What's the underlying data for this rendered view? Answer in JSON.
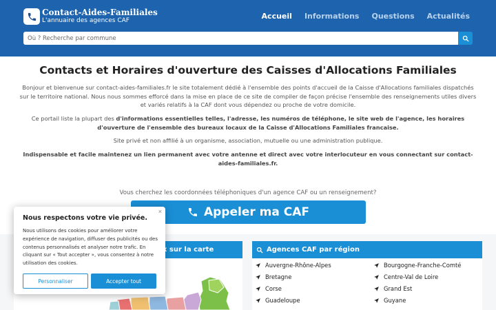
{
  "header": {
    "logo_title": "Contact-Aides-Familiales",
    "logo_subtitle": "L'annuaire des agences CAF",
    "nav": [
      "Accueil",
      "Informations",
      "Questions",
      "Actualités"
    ],
    "active_nav": "Accueil",
    "search": {
      "placeholder": "Où ? Recherche par commune",
      "value": ""
    }
  },
  "main": {
    "title": "Contacts et Horaires d'ouverture des Caisses d'Allocations Familiales",
    "intro": "Bonjour et bienvenue sur contact-aides-familiales.fr le site totalement dédié à l'ensemble des points d'accueil de la Caisse d'Allocations familiales dispatchés sur le territoire national. Nous nous sommes efforcé dans la mise en place de ce site de compiler de façon précise l'ensemble des renseignements utiles divers et variés relatifs à la CAF dont vous dépendez ou proche de votre domicile.",
    "portal_start": "Ce portail  liste la plupart des ",
    "portal_bold": "d'informations essentielles telles, l'adresse,  les numéros de téléphone, le site web de l'agence, les horaires d'ouverture de l'ensemble des bureaux locaux de la Caisse d'Allocations Familiales francaise.",
    "private": "Site privé et non affilié à un organisme, association, mutuelle ou une administration publique.",
    "link_text": "Indispensable et facile maintenez un lien permanent avec votre antenne et direct avec votre interlocuteur en vous connectant sur contact-aides-familiales.fr.",
    "question": "Vous cherchez les coordonnées téléphoniques d'un agence CAF ou un renseignement?",
    "call_button": "Appeler ma CAF"
  },
  "map_panel": {
    "title": "x sur la carte"
  },
  "regions_panel": {
    "title": "Agences CAF par région",
    "regions": [
      "Auvergne-Rhône-Alpes",
      "Bourgogne-Franche-Comté",
      "Bretagne",
      "Centre-Val de Loire",
      "Corse",
      "Grand Est",
      "Guadeloupe",
      "Guyane"
    ]
  },
  "cookie": {
    "close": "×",
    "title": "Nous respectons votre vie privée.",
    "text": "Nous utilisons des cookies pour améliorer votre expérience de navigation, diffuser des publicités ou des contenus personnalisés et analyser notre trafic. En cliquant sur « Tout accepter », vous consentez à notre utilisation des cookies.",
    "customize": "Personnaliser",
    "accept": "Accepter tout"
  },
  "colors": {
    "header": "#1e63ad",
    "accent": "#1a8fd6",
    "lower_bg": "#f4f6f8"
  },
  "icons": [
    "phone-icon",
    "search-icon",
    "magnifier-icon",
    "location-arrow-icon"
  ]
}
